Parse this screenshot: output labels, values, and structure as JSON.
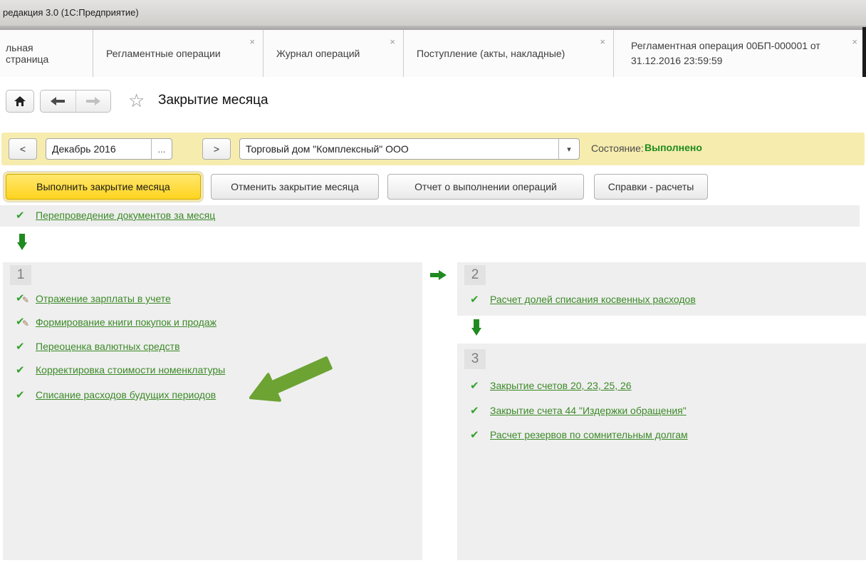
{
  "window": {
    "title": "редакция 3.0  (1С:Предприятие)"
  },
  "tabs": {
    "close_glyph": "×",
    "items": [
      {
        "label": "льная страница"
      },
      {
        "label": "Регламентные операции"
      },
      {
        "label": "Журнал операций"
      },
      {
        "label": "Поступление (акты, накладные)"
      },
      {
        "label": "Регламентная операция 00БП-000001 от 31.12.2016 23:59:59"
      }
    ]
  },
  "nav": {
    "title": "Закрытие месяца",
    "star_glyph": "☆"
  },
  "toolbar": {
    "prev_label": "<",
    "period_value": "Декабрь 2016",
    "period_more_label": "...",
    "next_label": ">",
    "organization_value": "Торговый дом \"Комплексный\" ООО",
    "dropdown_glyph": "▾",
    "status_label": "Состояние:",
    "status_value": "Выполнено"
  },
  "actions": {
    "run_label": "Выполнить закрытие месяца",
    "cancel_label": "Отменить закрытие месяца",
    "report_label": "Отчет о выполнении операций",
    "references_label": "Справки - расчеты"
  },
  "reposting": {
    "label": "Перепроведение документов за месяц"
  },
  "sections": {
    "one": {
      "number": "1",
      "items": [
        {
          "label": "Отражение зарплаты в учете"
        },
        {
          "label": "Формирование книги покупок и продаж"
        },
        {
          "label": "Переоценка валютных средств"
        },
        {
          "label": "Корректировка стоимости номенклатуры"
        },
        {
          "label": "Списание расходов будущих периодов"
        }
      ]
    },
    "two": {
      "number": "2",
      "items": [
        {
          "label": "Расчет долей списания косвенных расходов"
        }
      ]
    },
    "three": {
      "number": "3",
      "items": [
        {
          "label": "Закрытие счетов 20, 23, 25, 26"
        },
        {
          "label": "Закрытие счета 44 \"Издержки обращения\""
        },
        {
          "label": "Расчет резервов по сомнительным долгам"
        }
      ]
    }
  },
  "icons": {
    "check": "✔",
    "pencil": "✎"
  },
  "colors": {
    "link_green": "#3c8a28",
    "status_green": "#1d8b1d",
    "run_button_yellow": "#ffd41f",
    "toolbar_yellow": "#f6ecae",
    "flow_arrow_green": "#1f8a1f",
    "annotation_arrow_green": "#6ca333"
  }
}
